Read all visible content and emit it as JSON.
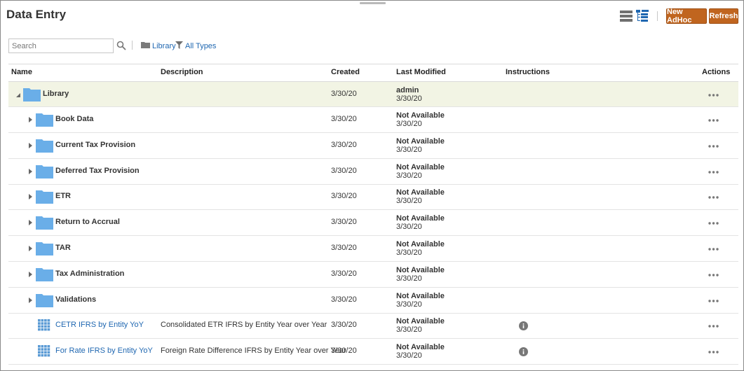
{
  "header": {
    "title": "Data Entry",
    "new_adhoc_label": "New AdHoc",
    "refresh_label": "Refresh",
    "accent_color": "#c0651f"
  },
  "toolbar": {
    "search_placeholder": "Search",
    "library_label": "Library",
    "types_label": "All Types"
  },
  "columns": {
    "name": "Name",
    "description": "Description",
    "created": "Created",
    "last_modified": "Last Modified",
    "instructions": "Instructions",
    "actions": "Actions"
  },
  "rows": [
    {
      "name": "Library",
      "type": "folder",
      "level": 0,
      "expanded": true,
      "description": "",
      "created": "3/30/20",
      "modified_by": "admin",
      "modified_date": "3/30/20"
    },
    {
      "name": "Book Data",
      "type": "folder",
      "level": 1,
      "expanded": false,
      "description": "",
      "created": "3/30/20",
      "modified_by": "Not Available",
      "modified_date": "3/30/20"
    },
    {
      "name": "Current Tax Provision",
      "type": "folder",
      "level": 1,
      "expanded": false,
      "description": "",
      "created": "3/30/20",
      "modified_by": "Not Available",
      "modified_date": "3/30/20"
    },
    {
      "name": "Deferred Tax Provision",
      "type": "folder",
      "level": 1,
      "expanded": false,
      "description": "",
      "created": "3/30/20",
      "modified_by": "Not Available",
      "modified_date": "3/30/20"
    },
    {
      "name": "ETR",
      "type": "folder",
      "level": 1,
      "expanded": false,
      "description": "",
      "created": "3/30/20",
      "modified_by": "Not Available",
      "modified_date": "3/30/20"
    },
    {
      "name": "Return to Accrual",
      "type": "folder",
      "level": 1,
      "expanded": false,
      "description": "",
      "created": "3/30/20",
      "modified_by": "Not Available",
      "modified_date": "3/30/20"
    },
    {
      "name": "TAR",
      "type": "folder",
      "level": 1,
      "expanded": false,
      "description": "",
      "created": "3/30/20",
      "modified_by": "Not Available",
      "modified_date": "3/30/20"
    },
    {
      "name": "Tax Administration",
      "type": "folder",
      "level": 1,
      "expanded": false,
      "description": "",
      "created": "3/30/20",
      "modified_by": "Not Available",
      "modified_date": "3/30/20"
    },
    {
      "name": "Validations",
      "type": "folder",
      "level": 1,
      "expanded": false,
      "description": "",
      "created": "3/30/20",
      "modified_by": "Not Available",
      "modified_date": "3/30/20"
    },
    {
      "name": "CETR IFRS by Entity YoY",
      "type": "form",
      "level": 1,
      "description": "Consolidated ETR IFRS by Entity Year over Year",
      "created": "3/30/20",
      "modified_by": "Not Available",
      "modified_date": "3/30/20",
      "has_instructions": true
    },
    {
      "name": "For Rate IFRS by Entity YoY",
      "type": "form",
      "level": 1,
      "description": "Foreign Rate Difference IFRS by Entity Year over Year",
      "created": "3/30/20",
      "modified_by": "Not Available",
      "modified_date": "3/30/20",
      "has_instructions": true
    }
  ],
  "icons": {
    "folder_color": "#6aaee8",
    "form_grid_color": "#5b9bd5",
    "info_color": "#777777",
    "link_color": "#1f67b1"
  }
}
